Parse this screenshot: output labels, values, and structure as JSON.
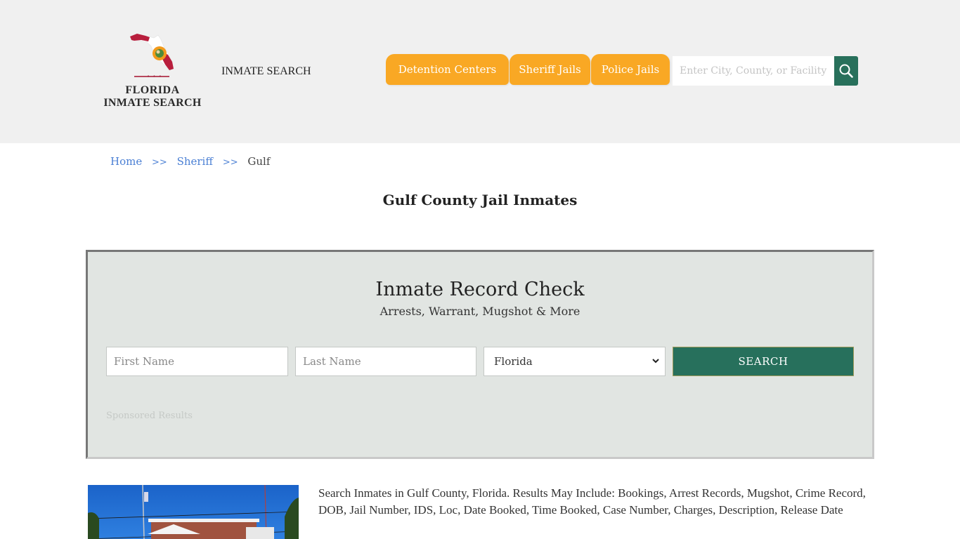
{
  "header": {
    "logo": {
      "line1": "FLORIDA",
      "line2": "INMATE SEARCH",
      "dots": "• • •",
      "icon": "florida-state-flag-map"
    },
    "site_title": "INMATE SEARCH",
    "nav_tabs": [
      {
        "label": "Detention Centers"
      },
      {
        "label": "Sheriff Jails"
      },
      {
        "label": "Police Jails"
      }
    ],
    "search": {
      "placeholder": "Enter City, County, or Facility",
      "value": "",
      "icon": "search-icon"
    }
  },
  "breadcrumb": {
    "items": [
      {
        "label": "Home"
      },
      {
        "label": "Sheriff"
      }
    ],
    "separator": ">>",
    "current": "Gulf"
  },
  "page_title": "Gulf County Jail Inmates",
  "record_check": {
    "title": "Inmate Record Check",
    "subtitle": "Arrests, Warrant, Mugshot & More",
    "first_name_placeholder": "First Name",
    "last_name_placeholder": "Last Name",
    "state_selected": "Florida",
    "search_label": "SEARCH",
    "sponsored_label": "Sponsored Results"
  },
  "content": {
    "description": "Search Inmates in Gulf County, Florida. Results May Include: Bookings, Arrest Records, Mugshot, Crime Record, DOB, Jail Number, IDS, Loc, Date Booked, Time Booked, Case Number, Charges, Description, Release Date",
    "photo_alt": "Gulf County Jail building"
  },
  "colors": {
    "header_bg": "#f0f0f0",
    "tab_orange": "#f9a824",
    "accent_green": "#27705c",
    "link_blue": "#4a7fd4",
    "record_box_bg": "#e1e5e2"
  }
}
